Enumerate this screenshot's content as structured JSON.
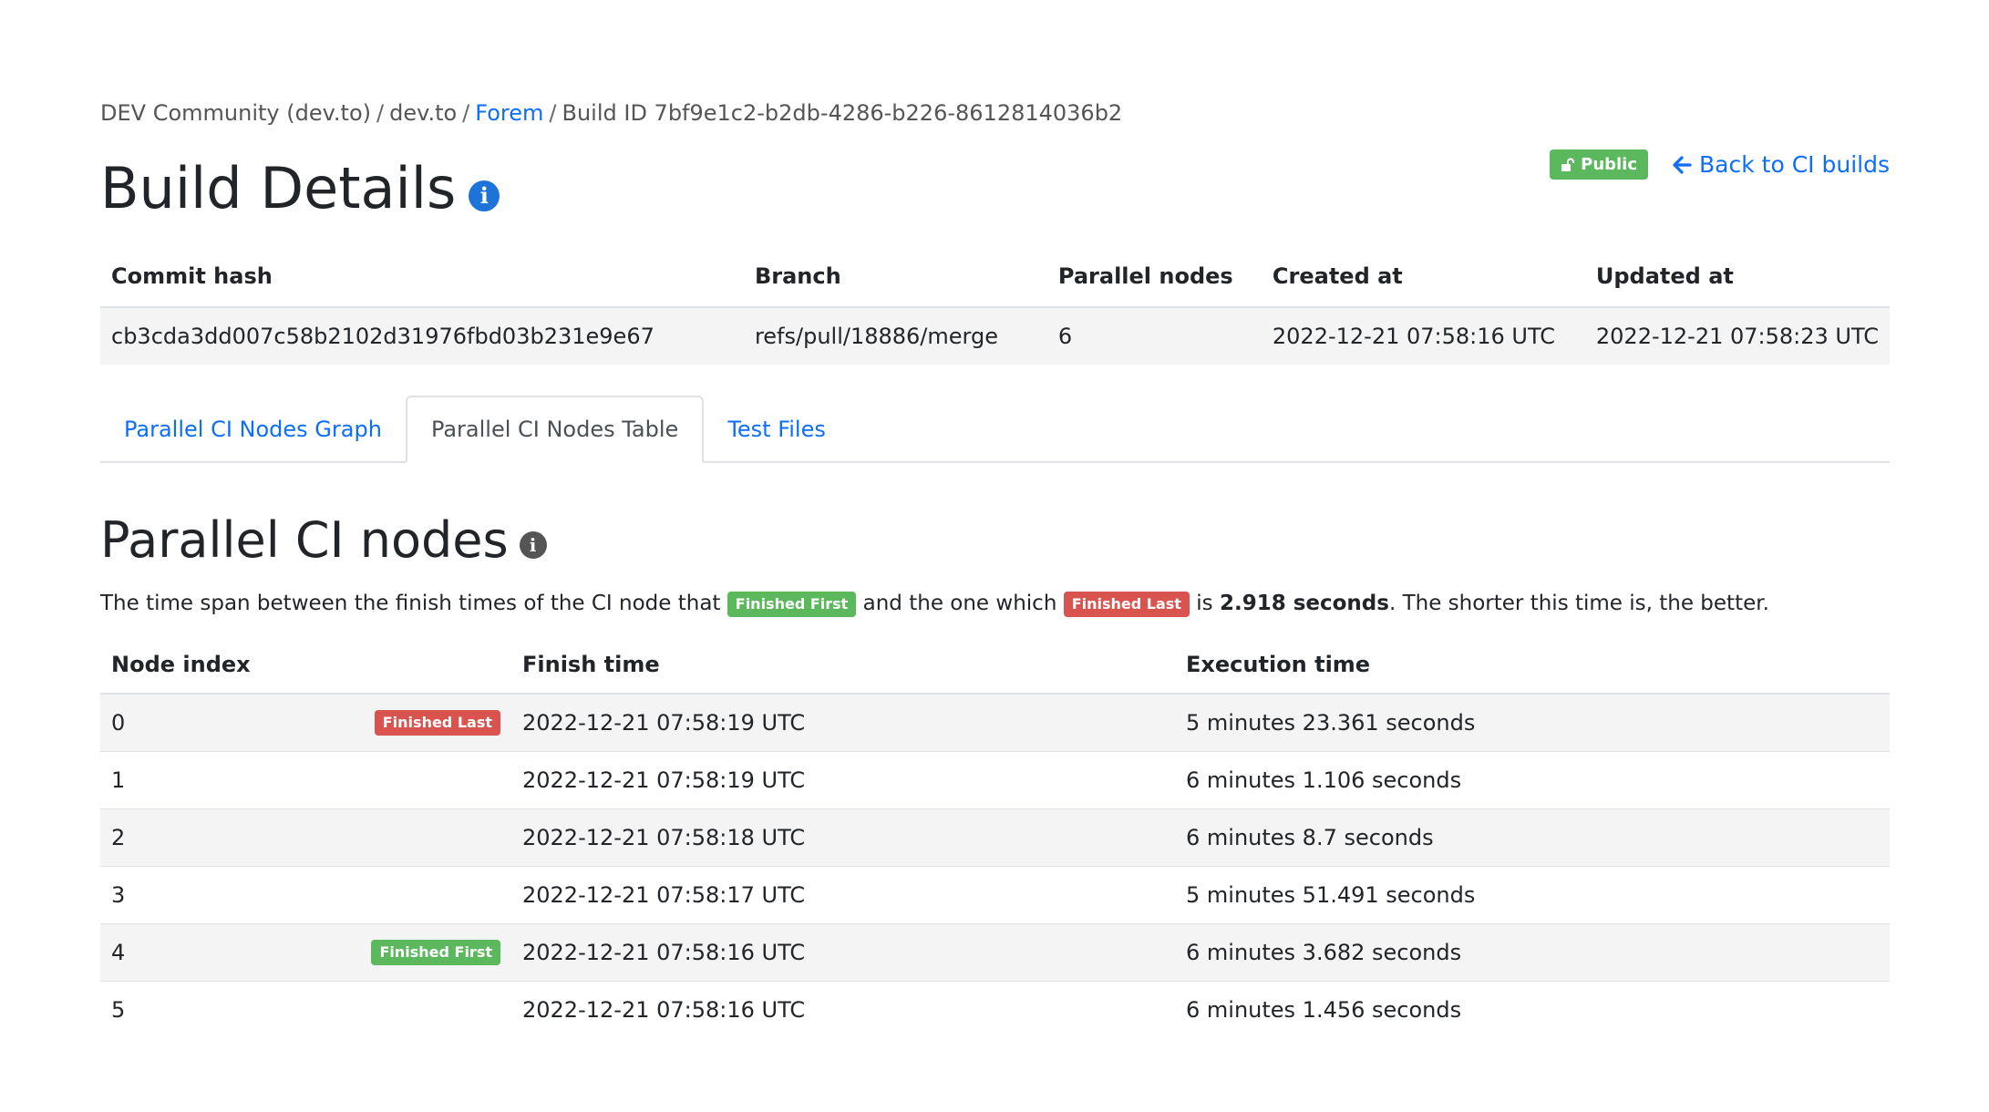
{
  "breadcrumb": {
    "org": "DEV Community (dev.to)",
    "project": "dev.to",
    "repo": "Forem",
    "build": "Build ID 7bf9e1c2-b2db-4286-b226-8612814036b2",
    "separator": "/"
  },
  "header": {
    "title": "Build Details",
    "info_icon": "i",
    "public_label": "Public",
    "back_label": "Back to CI builds"
  },
  "build_table": {
    "headers": [
      "Commit hash",
      "Branch",
      "Parallel nodes",
      "Created at",
      "Updated at"
    ],
    "row": [
      "cb3cda3dd007c58b2102d31976fbd03b231e9e67",
      "refs/pull/18886/merge",
      "6",
      "2022-12-21 07:58:16 UTC",
      "2022-12-21 07:58:23 UTC"
    ]
  },
  "tabs": [
    {
      "label": "Parallel CI Nodes Graph",
      "active": false
    },
    {
      "label": "Parallel CI Nodes Table",
      "active": true
    },
    {
      "label": "Test Files",
      "active": false
    }
  ],
  "section": {
    "title": "Parallel CI nodes",
    "info_icon": "i",
    "summary_prefix": "The time span between the finish times of the CI node that",
    "finished_first_label": "Finished First",
    "summary_middle": "and the one which",
    "finished_last_label": "Finished Last",
    "summary_is": "is",
    "summary_value": "2.918 seconds",
    "summary_suffix": ". The shorter this time is, the better."
  },
  "nodes_table": {
    "headers": [
      "Node index",
      "Finish time",
      "Execution time"
    ],
    "rows": [
      {
        "index": "0",
        "badge": "Finished Last",
        "finish": "2022-12-21 07:58:19 UTC",
        "exec": "5 minutes 23.361 seconds"
      },
      {
        "index": "1",
        "badge": "",
        "finish": "2022-12-21 07:58:19 UTC",
        "exec": "6 minutes 1.106 seconds"
      },
      {
        "index": "2",
        "badge": "",
        "finish": "2022-12-21 07:58:18 UTC",
        "exec": "6 minutes 8.7 seconds"
      },
      {
        "index": "3",
        "badge": "",
        "finish": "2022-12-21 07:58:17 UTC",
        "exec": "5 minutes 51.491 seconds"
      },
      {
        "index": "4",
        "badge": "Finished First",
        "finish": "2022-12-21 07:58:16 UTC",
        "exec": "6 minutes 3.682 seconds"
      },
      {
        "index": "5",
        "badge": "",
        "finish": "2022-12-21 07:58:16 UTC",
        "exec": "6 minutes 1.456 seconds"
      }
    ]
  },
  "colors": {
    "link": "#0d6efd",
    "badge_green": "#5cb85c",
    "badge_red": "#d9534f",
    "info_blue": "#1e73d8"
  }
}
